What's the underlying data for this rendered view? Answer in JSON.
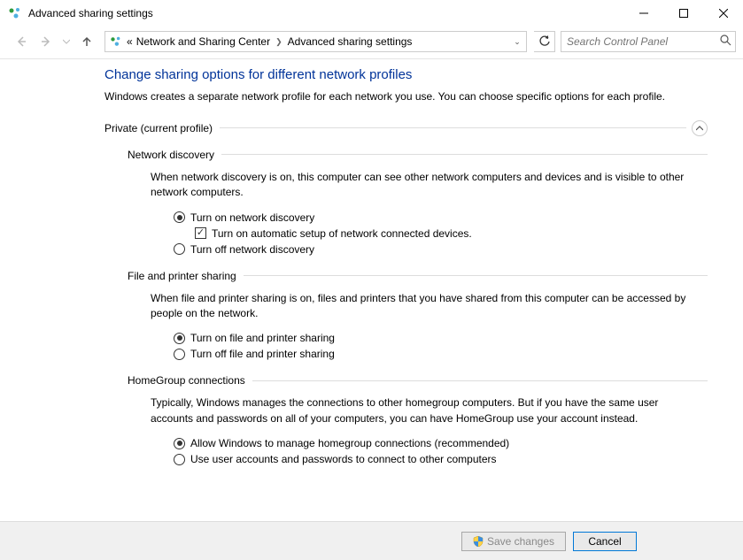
{
  "window": {
    "title": "Advanced sharing settings"
  },
  "breadcrumb": {
    "prefix": "«",
    "item1": "Network and Sharing Center",
    "item2": "Advanced sharing settings"
  },
  "search": {
    "placeholder": "Search Control Panel"
  },
  "page": {
    "title": "Change sharing options for different network profiles",
    "desc": "Windows creates a separate network profile for each network you use. You can choose specific options for each profile."
  },
  "section_private": {
    "label": "Private (current profile)"
  },
  "network_discovery": {
    "label": "Network discovery",
    "desc": "When network discovery is on, this computer can see other network computers and devices and is visible to other network computers.",
    "opt_on": "Turn on network discovery",
    "opt_auto": "Turn on automatic setup of network connected devices.",
    "opt_off": "Turn off network discovery"
  },
  "file_printer": {
    "label": "File and printer sharing",
    "desc": "When file and printer sharing is on, files and printers that you have shared from this computer can be accessed by people on the network.",
    "opt_on": "Turn on file and printer sharing",
    "opt_off": "Turn off file and printer sharing"
  },
  "homegroup": {
    "label": "HomeGroup connections",
    "desc": "Typically, Windows manages the connections to other homegroup computers. But if you have the same user accounts and passwords on all of your computers, you can have HomeGroup use your account instead.",
    "opt_allow": "Allow Windows to manage homegroup connections (recommended)",
    "opt_user": "Use user accounts and passwords to connect to other computers"
  },
  "buttons": {
    "save": "Save changes",
    "cancel": "Cancel"
  }
}
